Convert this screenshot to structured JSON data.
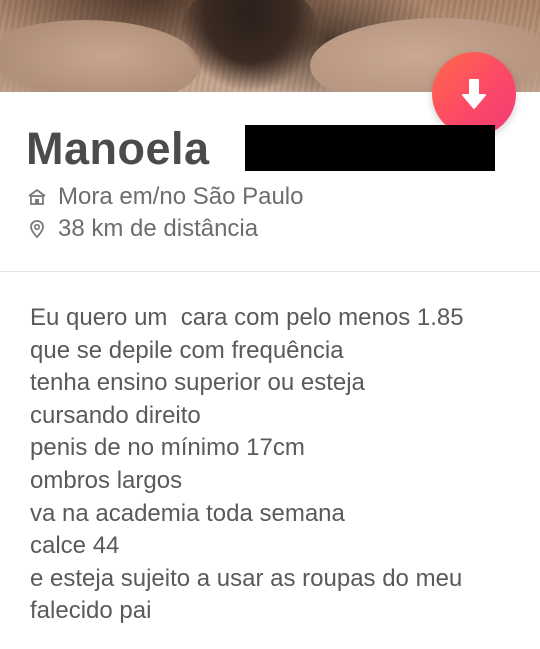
{
  "profile": {
    "name": "Manoela",
    "residence": "Mora em/no São Paulo",
    "distance": "38 km de distância"
  },
  "icons": {
    "collapse": "arrow-down-icon",
    "residence": "home-icon",
    "distance": "location-pin-icon"
  },
  "colors": {
    "accent_start": "#ff6b4a",
    "accent_end": "#f23a7a",
    "text": "#505050",
    "divider": "#e4e4e4"
  },
  "bio": {
    "lines": [
      "Eu quero um  cara com pelo menos 1.85",
      "que se depile com frequência",
      "tenha ensino superior ou esteja",
      "cursando direito",
      "penis de no mínimo 17cm",
      "ombros largos",
      "va na academia toda semana",
      "calce 44",
      "e esteja sujeito a usar as roupas do meu",
      "falecido pai"
    ]
  }
}
